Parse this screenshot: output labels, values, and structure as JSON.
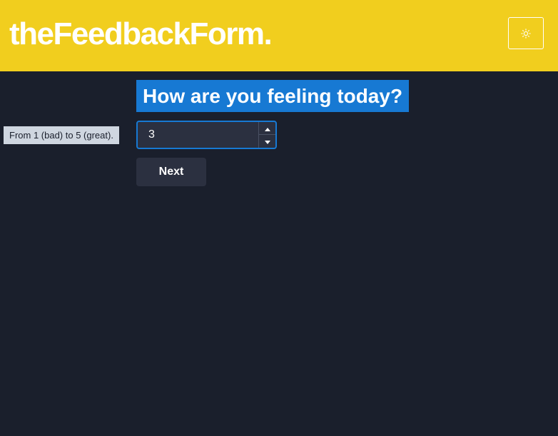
{
  "header": {
    "brand": "theFeedbackForm.",
    "theme_toggle_icon": "sun-icon"
  },
  "question": {
    "title": "How are you feeling today?",
    "hint": "From 1 (bad) to 5 (great).",
    "value": "3",
    "stepper_up_icon": "caret-up-icon",
    "stepper_down_icon": "caret-down-icon"
  },
  "actions": {
    "next_label": "Next"
  },
  "colors": {
    "header_bg": "#f1ce1e",
    "page_bg": "#1a1f2c",
    "accent": "#1779d3",
    "control_bg": "#2b3040",
    "hint_bg": "#cfd6e0"
  }
}
